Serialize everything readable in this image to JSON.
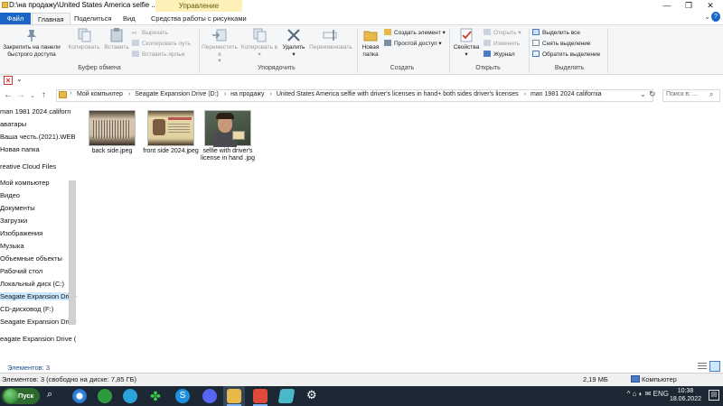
{
  "window": {
    "title": "D:\\на продажу\\United States America selfie ...",
    "context_group": "Управление",
    "controls": {
      "minimize": "—",
      "maximize": "❐",
      "close": "✕"
    }
  },
  "tabs": [
    {
      "label": "Файл"
    },
    {
      "label": "Главная"
    },
    {
      "label": "Поделиться"
    },
    {
      "label": "Вид"
    },
    {
      "label": "Средства работы с рисунками"
    }
  ],
  "ribbon": {
    "clipboard": {
      "group_label": "Буфер обмена",
      "pin_label": "Закрепить на панели быстрого доступа",
      "copy_label": "Копировать",
      "paste_label": "Вставить",
      "cut_label": "Вырезать",
      "copy_path_label": "Скопировать путь",
      "paste_shortcut_label": "Вставить ярлык"
    },
    "organize": {
      "group_label": "Упорядочить",
      "move_label": "Переместить в",
      "copy_to_label": "Копировать в",
      "delete_label": "Удалить",
      "rename_label": "Переименовать"
    },
    "new": {
      "group_label": "Создать",
      "new_folder_label": "Новая папка",
      "new_item_label": "Создать элемент",
      "easy_access_label": "Простой доступ"
    },
    "open": {
      "group_label": "Открыть",
      "properties_label": "Свойства",
      "open_label": "Открыть",
      "edit_label": "Изменить",
      "history_label": "Журнал"
    },
    "select": {
      "group_label": "Выделить",
      "select_all_label": "Выделить все",
      "select_none_label": "Снять выделение",
      "invert_label": "Обратить выделение"
    }
  },
  "address": {
    "crumbs": [
      "Мой компьютер",
      "Seagate Expansion Drive (D:)",
      "на продажу",
      "United States America selfie with driver's licenses in hand+ both sides driver's licenses",
      "man 1981 2024 california"
    ],
    "search_placeholder": "Поиск в: ..."
  },
  "nav": {
    "items": [
      "man 1981 2024 californ",
      "аватары",
      "Ваша честь.(2021).WEB",
      "Новая папка",
      "reative Cloud Files",
      "Мой компьютер",
      "Видео",
      "Документы",
      "Загрузки",
      "Изображения",
      "Музыка",
      "Объемные объекты",
      "Рабочий стол",
      "Локальный диск (C:)",
      "Seagate Expansion Drive",
      "CD-дисковод (F:)",
      "Seagate Expansion Drive",
      "eagate Expansion Drive ("
    ],
    "selected_index": 14
  },
  "files": [
    {
      "name": "back side.jpeg"
    },
    {
      "name": "front side 2024.jpeg"
    },
    {
      "name": "selfie with driver's license in hand .jpg"
    }
  ],
  "status": {
    "count": "Элементов: 3",
    "details": "Элементов: 3 (свободно на диске: 7,85 ГБ)",
    "size": "2,19 МБ",
    "location": "Компьютер"
  },
  "taskbar": {
    "start_label": "Пуск",
    "tray": "^ ⌂ ◐ ✉ ENG",
    "time": "10:38",
    "date": "18.06.2022"
  },
  "colors": {
    "file_tab": "#1a66c6",
    "context_group": "#fdf0b8",
    "selection": "#cce8ff",
    "taskbar": "#1c2833"
  }
}
